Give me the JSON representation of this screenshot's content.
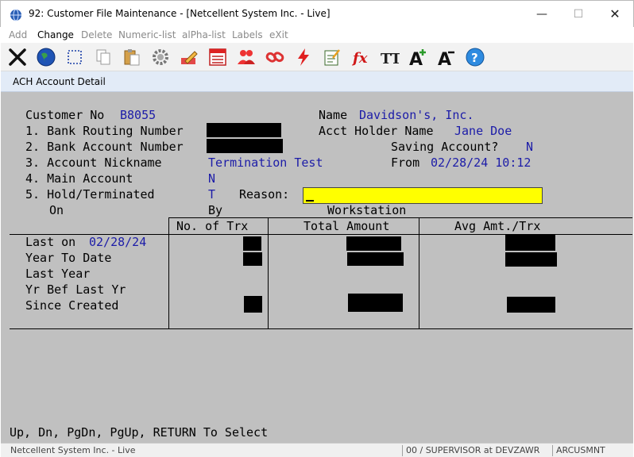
{
  "window": {
    "title": "92: Customer File Maintenance - [Netcellent System Inc. - Live]",
    "minimize_glyph": "—",
    "maximize_glyph": "☐",
    "close_glyph": "✕"
  },
  "menu": {
    "items": [
      "Add",
      "Change",
      "Delete",
      "Numeric-list",
      "alPha-list",
      "Labels",
      "eXit"
    ],
    "active": "Change"
  },
  "toolbar": {
    "icons": [
      "close-x-icon",
      "globe-icon",
      "select-box-icon",
      "copy-icon",
      "paste-icon",
      "settings-gear-icon",
      "edit-pencil-icon",
      "report-list-icon",
      "users-icon",
      "link-icon",
      "lightning-icon",
      "notepad-icon",
      "fx-icon",
      "text-size-icon",
      "font-increase-icon",
      "font-decrease-icon",
      "help-icon"
    ],
    "fx_label": "fx",
    "tt_label": "TT",
    "font_plus_label": "A",
    "font_minus_label": "A",
    "help_label": "?"
  },
  "subtitle": "ACH Account Detail",
  "form": {
    "customer_no_label": "Customer No",
    "customer_no": "B8055",
    "name_label": "Name",
    "name": "Davidson's, Inc.",
    "routing_label": "1. Bank Routing Number",
    "acct_holder_label": "Acct Holder Name",
    "acct_holder": "Jane Doe",
    "account_label": "2. Bank Account Number",
    "saving_label": "Saving Account?",
    "saving": "N",
    "nickname_label": "3. Account Nickname",
    "nickname": "Termination Test",
    "from_label": "From",
    "from": "02/28/24 10:12",
    "main_label": "4. Main Account",
    "main": "N",
    "hold_label": "5. Hold/Terminated",
    "hold": "T",
    "reason_label": "Reason:",
    "reason_value": "",
    "on_label": "On",
    "by_label": "By",
    "workstation_label": "Workstation"
  },
  "table": {
    "headers": [
      "No. of Trx",
      "Total Amount",
      "Avg Amt./Trx"
    ],
    "rows": [
      {
        "label": "Last on",
        "date": "02/28/24"
      },
      {
        "label": "Year To Date"
      },
      {
        "label": "Last Year"
      },
      {
        "label": "Yr Bef Last Yr"
      },
      {
        "label": "Since Created"
      }
    ]
  },
  "footer": "Up, Dn, PgDn, PgUp, RETURN To Select",
  "status": {
    "left": "Netcellent System Inc. - Live",
    "middle": "00 / SUPERVISOR at DEVZAWR",
    "right": "ARCUSMNT"
  },
  "colors": {
    "terminal_bg": "#c0c0c0",
    "value_text": "#1c1ca8",
    "reason_field": "#ffff00",
    "subtitle_bar": "#e2ebf7"
  }
}
